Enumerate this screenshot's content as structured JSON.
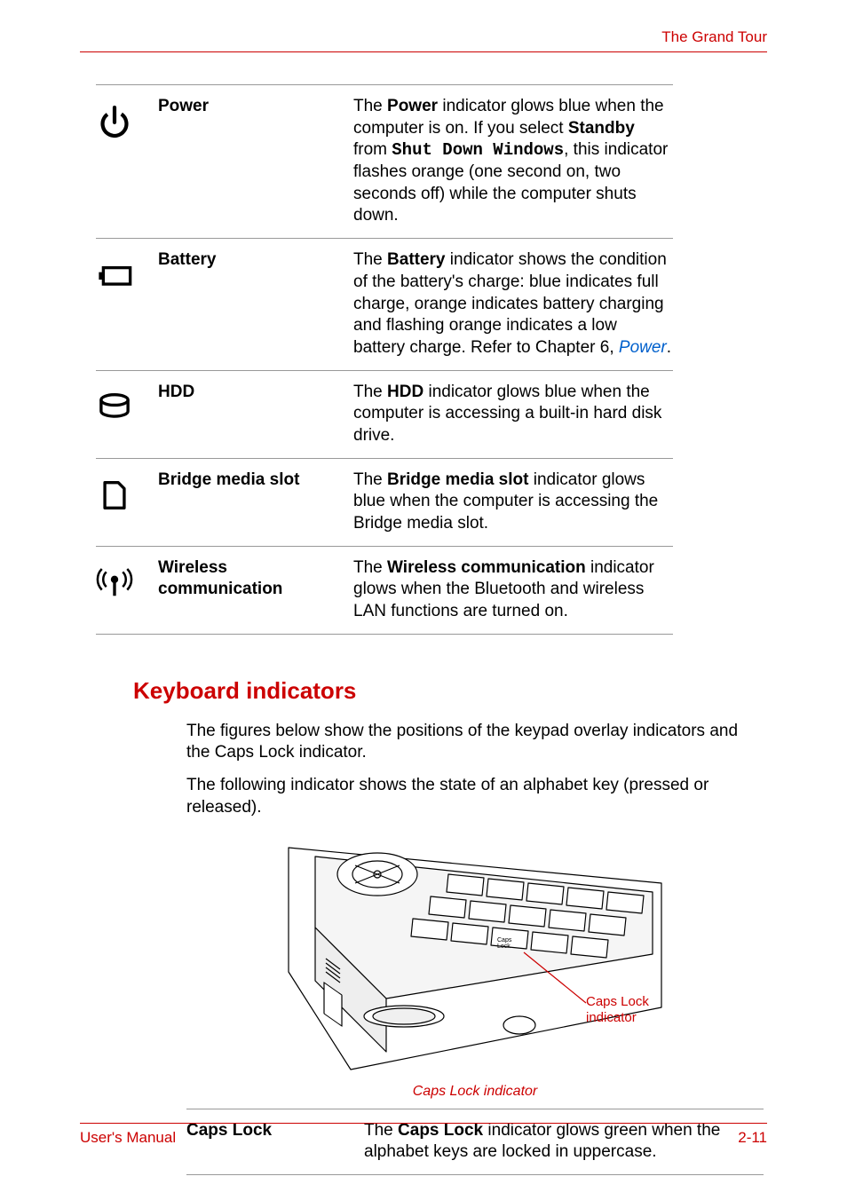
{
  "header": {
    "chapter_title": "The Grand Tour"
  },
  "indicators": [
    {
      "icon": "power-icon",
      "label": "Power",
      "desc_parts": [
        {
          "t": "text",
          "v": "The "
        },
        {
          "t": "bold",
          "v": "Power"
        },
        {
          "t": "text",
          "v": " indicator glows blue when the computer is on. If you select "
        },
        {
          "t": "bold",
          "v": "Standby"
        },
        {
          "t": "text",
          "v": " from "
        },
        {
          "t": "mono",
          "v": "Shut Down Windows"
        },
        {
          "t": "text",
          "v": ", this indicator flashes orange (one second on, two seconds off) while the computer shuts down."
        }
      ]
    },
    {
      "icon": "battery-icon",
      "label": "Battery",
      "desc_parts": [
        {
          "t": "text",
          "v": "The "
        },
        {
          "t": "bold",
          "v": "Battery"
        },
        {
          "t": "text",
          "v": " indicator shows the condition of the battery's charge: blue indicates full charge, orange indicates battery charging and flashing orange indicates a low battery charge. Refer to Chapter 6, "
        },
        {
          "t": "link",
          "v": "Power"
        },
        {
          "t": "text",
          "v": "."
        }
      ]
    },
    {
      "icon": "hdd-icon",
      "label": "HDD",
      "desc_parts": [
        {
          "t": "text",
          "v": "The "
        },
        {
          "t": "bold",
          "v": "HDD"
        },
        {
          "t": "text",
          "v": " indicator glows blue when the computer is accessing a built-in hard disk drive."
        }
      ]
    },
    {
      "icon": "bridge-media-icon",
      "label": "Bridge media slot",
      "desc_parts": [
        {
          "t": "text",
          "v": "The "
        },
        {
          "t": "bold",
          "v": "Bridge media slot"
        },
        {
          "t": "text",
          "v": " indicator glows blue when the computer is accessing the Bridge media slot."
        }
      ]
    },
    {
      "icon": "wireless-icon",
      "label": "Wireless communication",
      "desc_parts": [
        {
          "t": "text",
          "v": "The "
        },
        {
          "t": "bold",
          "v": "Wireless communication"
        },
        {
          "t": "text",
          "v": " indicator glows when the Bluetooth and wireless LAN functions are turned on."
        }
      ]
    }
  ],
  "section2": {
    "heading": "Keyboard indicators",
    "para1": "The figures below show the positions of the keypad overlay indicators and the Caps Lock indicator.",
    "para2": "The following indicator shows the state of an alphabet key (pressed or released).",
    "figure": {
      "callout_label": "Caps Lock indicator",
      "caption": "Caps Lock indicator"
    },
    "table": [
      {
        "label": "Caps Lock",
        "desc_parts": [
          {
            "t": "text",
            "v": "The "
          },
          {
            "t": "bold",
            "v": "Caps Lock"
          },
          {
            "t": "text",
            "v": " indicator glows green when the alphabet keys are locked in uppercase."
          }
        ]
      }
    ]
  },
  "footer": {
    "left": "User's Manual",
    "right": "2-11"
  }
}
